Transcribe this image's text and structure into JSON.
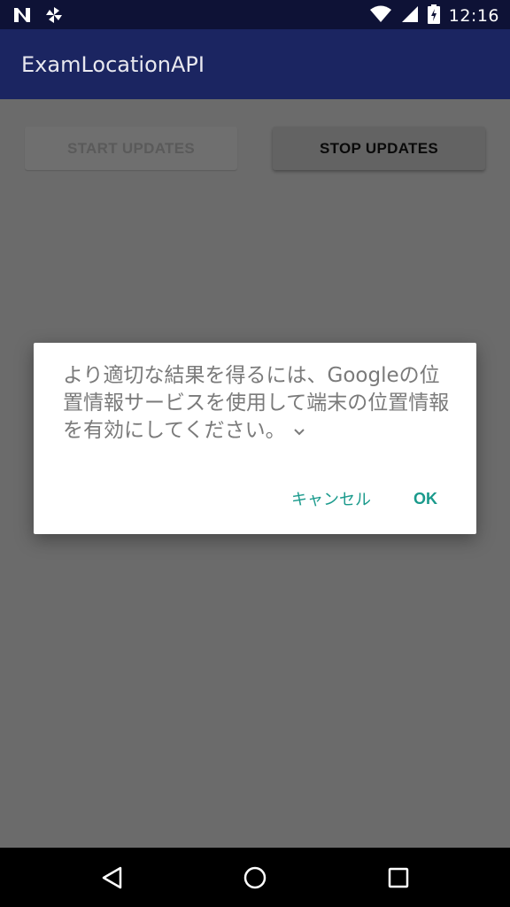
{
  "status_bar": {
    "time": "12:16",
    "icons": [
      "n-notification-icon",
      "pinwheel-icon",
      "wifi-icon",
      "signal-icon",
      "battery-charging-icon"
    ]
  },
  "app_bar": {
    "title": "ExamLocationAPI"
  },
  "buttons": {
    "start_label": "START UPDATES",
    "stop_label": "STOP UPDATES"
  },
  "dialog": {
    "message": "より適切な結果を得るには、Googleの位置情報サービスを使用して端末の位置情報を有効にしてください。",
    "cancel_label": "キャンセル",
    "ok_label": "OK"
  },
  "nav_bar": {
    "icons": [
      "back-icon",
      "home-icon",
      "recent-apps-icon"
    ]
  },
  "colors": {
    "status_bar": "#0e1236",
    "app_bar": "#1b2561",
    "dim_background": "#6b6b6b",
    "accent": "#1a9a8c"
  }
}
